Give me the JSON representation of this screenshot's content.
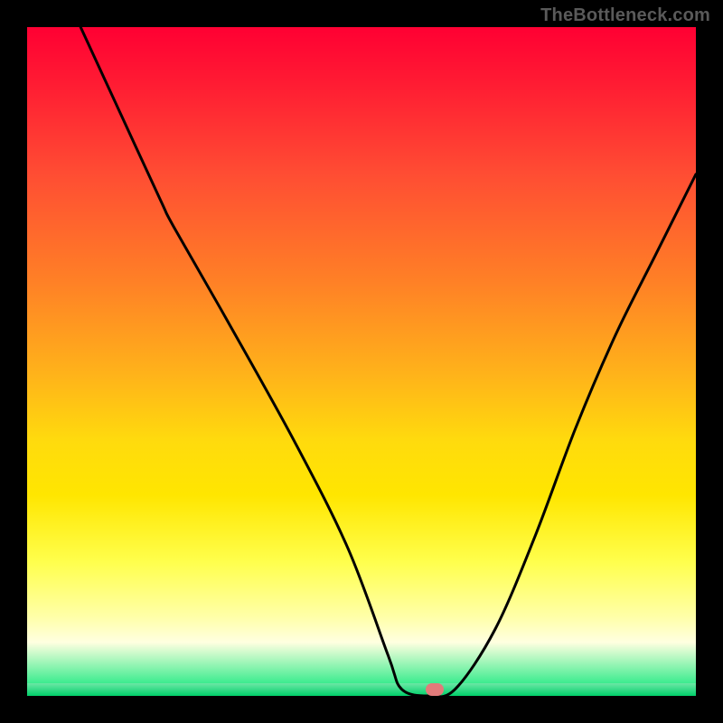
{
  "watermark": {
    "text": "TheBottleneck.com"
  },
  "chart_data": {
    "type": "line",
    "title": "",
    "xlabel": "",
    "ylabel": "",
    "xlim": [
      0,
      100
    ],
    "ylim": [
      0,
      100
    ],
    "grid": false,
    "gradient_colors": [
      "#ff0033",
      "#ff8026",
      "#ffe600",
      "#ffffe0",
      "#00e676"
    ],
    "series": [
      {
        "name": "bottleneck-curve",
        "x": [
          8,
          14,
          20,
          22,
          30,
          40,
          48,
          54,
          56,
          60,
          64,
          70,
          76,
          82,
          88,
          94,
          100
        ],
        "values": [
          100,
          87,
          74,
          70,
          56,
          38,
          22,
          6,
          1,
          0,
          1,
          10,
          24,
          40,
          54,
          66,
          78
        ]
      }
    ],
    "marker": {
      "x": 61,
      "y": 0,
      "color": "#e27a7a"
    }
  },
  "layout": {
    "plot_left": 30,
    "plot_top": 30,
    "plot_size": 740
  }
}
